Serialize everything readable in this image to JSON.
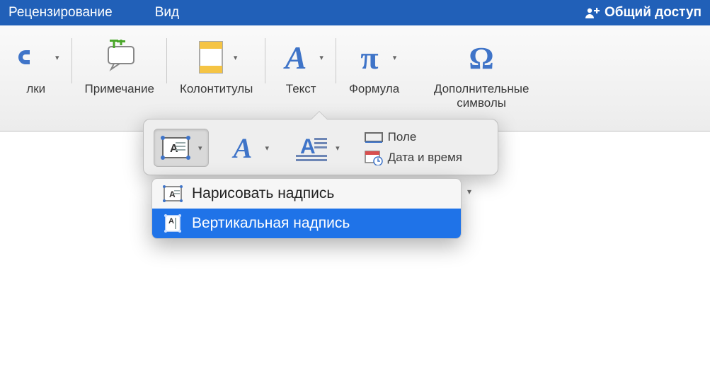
{
  "menubar": {
    "tabs": [
      "Рецензирование",
      "Вид"
    ],
    "share": "Общий доступ"
  },
  "ribbon": {
    "links": "лки",
    "comment": "Примечание",
    "headers": "Колонтитулы",
    "text": "Текст",
    "formula": "Формула",
    "symbols": "Дополнительные символы"
  },
  "popover": {
    "field": "Поле",
    "datetime": "Дата и время"
  },
  "menu": {
    "draw_textbox": "Нарисовать надпись",
    "vertical_textbox": "Вертикальная надпись"
  }
}
